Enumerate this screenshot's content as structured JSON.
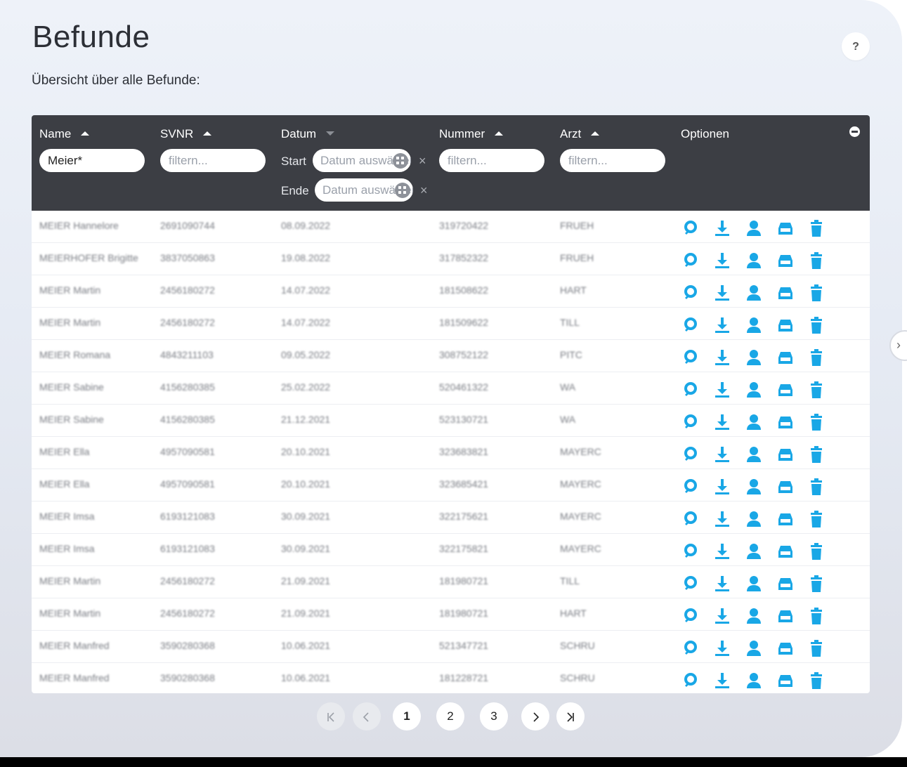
{
  "page": {
    "title": "Befunde",
    "subtitle": "Übersicht über alle Befunde:",
    "help_label": "?"
  },
  "table": {
    "columns": [
      {
        "key": "name",
        "label": "Name",
        "sort": "asc"
      },
      {
        "key": "svnr",
        "label": "SVNR",
        "sort": "asc"
      },
      {
        "key": "datum",
        "label": "Datum",
        "sort": "desc"
      },
      {
        "key": "nummer",
        "label": "Nummer",
        "sort": "asc"
      },
      {
        "key": "arzt",
        "label": "Arzt",
        "sort": "asc"
      },
      {
        "key": "optionen",
        "label": "Optionen"
      }
    ],
    "filters": {
      "name_value": "Meier*",
      "placeholder": "filtern...",
      "date_start_label": "Start",
      "date_end_label": "Ende",
      "date_placeholder": "Datum auswählen",
      "clear_glyph": "×"
    },
    "rows": [
      {
        "name": "MEIER Hannelore",
        "svnr": "2691090744",
        "datum": "08.09.2022",
        "nummer": "319720422",
        "arzt": "FRUEH"
      },
      {
        "name": "MEIERHOFER Brigitte",
        "svnr": "3837050863",
        "datum": "19.08.2022",
        "nummer": "317852322",
        "arzt": "FRUEH"
      },
      {
        "name": "MEIER Martin",
        "svnr": "2456180272",
        "datum": "14.07.2022",
        "nummer": "181508622",
        "arzt": "HART"
      },
      {
        "name": "MEIER Martin",
        "svnr": "2456180272",
        "datum": "14.07.2022",
        "nummer": "181509622",
        "arzt": "TILL"
      },
      {
        "name": "MEIER Romana",
        "svnr": "4843211103",
        "datum": "09.05.2022",
        "nummer": "308752122",
        "arzt": "PITC"
      },
      {
        "name": "MEIER Sabine",
        "svnr": "4156280385",
        "datum": "25.02.2022",
        "nummer": "520461322",
        "arzt": "WA"
      },
      {
        "name": "MEIER Sabine",
        "svnr": "4156280385",
        "datum": "21.12.2021",
        "nummer": "523130721",
        "arzt": "WA"
      },
      {
        "name": "MEIER Ella",
        "svnr": "4957090581",
        "datum": "20.10.2021",
        "nummer": "323683821",
        "arzt": "MAYERC"
      },
      {
        "name": "MEIER Ella",
        "svnr": "4957090581",
        "datum": "20.10.2021",
        "nummer": "323685421",
        "arzt": "MAYERC"
      },
      {
        "name": "MEIER Imsa",
        "svnr": "6193121083",
        "datum": "30.09.2021",
        "nummer": "322175621",
        "arzt": "MAYERC"
      },
      {
        "name": "MEIER Imsa",
        "svnr": "6193121083",
        "datum": "30.09.2021",
        "nummer": "322175821",
        "arzt": "MAYERC"
      },
      {
        "name": "MEIER Martin",
        "svnr": "2456180272",
        "datum": "21.09.2021",
        "nummer": "181980721",
        "arzt": "TILL"
      },
      {
        "name": "MEIER Martin",
        "svnr": "2456180272",
        "datum": "21.09.2021",
        "nummer": "181980721",
        "arzt": "HART"
      },
      {
        "name": "MEIER Manfred",
        "svnr": "3590280368",
        "datum": "10.06.2021",
        "nummer": "521347721",
        "arzt": "SCHRU"
      },
      {
        "name": "MEIER Manfred",
        "svnr": "3590280368",
        "datum": "10.06.2021",
        "nummer": "181228721",
        "arzt": "SCHRU"
      }
    ],
    "row_actions": [
      "search-icon",
      "download-icon",
      "user-icon",
      "archive-icon",
      "trash-icon"
    ],
    "accent_color": "#19a7e6",
    "header_color": "#3c3e44"
  },
  "pagination": {
    "first_label": "K",
    "prev_label": "‹",
    "pages": [
      "1",
      "2",
      "3"
    ],
    "current_page": "1",
    "next_label": "›",
    "last_label": "›|"
  },
  "side_arrow_label": "›"
}
